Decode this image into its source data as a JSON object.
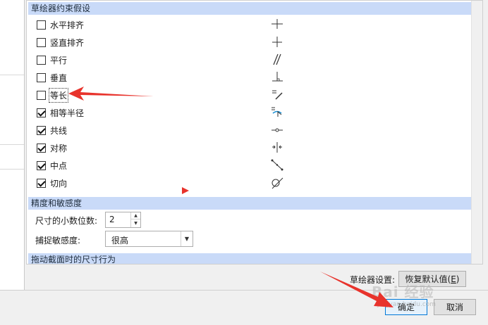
{
  "sections": {
    "constraints_header": "草绘器约束假设",
    "precision_header": "精度和敏感度",
    "drag_header": "拖动截面时的尺寸行为"
  },
  "constraints": [
    {
      "label": "水平排齐",
      "checked": false,
      "icon": "horizontal-align-icon"
    },
    {
      "label": "竖直排齐",
      "checked": false,
      "icon": "vertical-align-icon"
    },
    {
      "label": "平行",
      "checked": false,
      "icon": "parallel-icon"
    },
    {
      "label": "垂直",
      "checked": false,
      "icon": "perpendicular-icon"
    },
    {
      "label": "等长",
      "checked": false,
      "icon": "equal-length-icon"
    },
    {
      "label": "相等半径",
      "checked": true,
      "icon": "equal-radius-icon"
    },
    {
      "label": "共线",
      "checked": true,
      "icon": "collinear-icon"
    },
    {
      "label": "对称",
      "checked": true,
      "icon": "symmetric-icon"
    },
    {
      "label": "中点",
      "checked": true,
      "icon": "midpoint-icon"
    },
    {
      "label": "切向",
      "checked": true,
      "icon": "tangent-icon"
    }
  ],
  "precision": {
    "decimals_label": "尺寸的小数位数:",
    "decimals_value": "2",
    "sensitivity_label": "捕捉敏感度:",
    "sensitivity_value": "很高"
  },
  "footer": {
    "sketcher_settings_label": "草绘器设置:",
    "reset_label": "恢复默认值(",
    "reset_key": "E",
    "reset_close": ")",
    "ok_label": "确定",
    "cancel_label": "取消"
  },
  "watermark": {
    "text": "Bai 经验",
    "sub": "jingyan.baidu.com"
  },
  "colors": {
    "section_header_bg": "#c9daf8",
    "annotation_red": "#e8332c",
    "ok_border": "#0078d7"
  }
}
